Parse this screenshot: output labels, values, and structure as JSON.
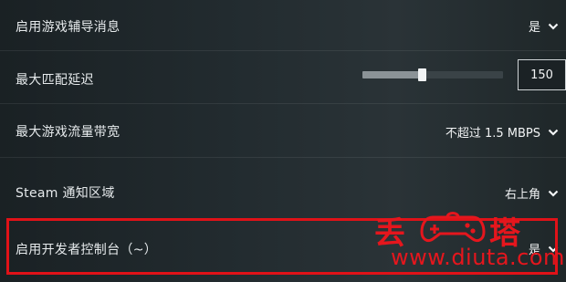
{
  "settings": [
    {
      "label": "启用游戏辅导消息",
      "value": "是"
    },
    {
      "label": "最大匹配延迟",
      "slider_fraction": 0.42,
      "input_value": "150"
    },
    {
      "label": "最大游戏流量带宽",
      "value": "不超过 1.5 MBPS"
    },
    {
      "label": "Steam 通知区域",
      "value": "右上角"
    },
    {
      "label": "启用开发者控制台（~）",
      "value": "是"
    }
  ],
  "watermark": {
    "left_char": "丢",
    "right_char": "塔",
    "url": "www.diuta.com"
  },
  "colors": {
    "highlight": "#e01218",
    "watermark": "#e5161d"
  }
}
